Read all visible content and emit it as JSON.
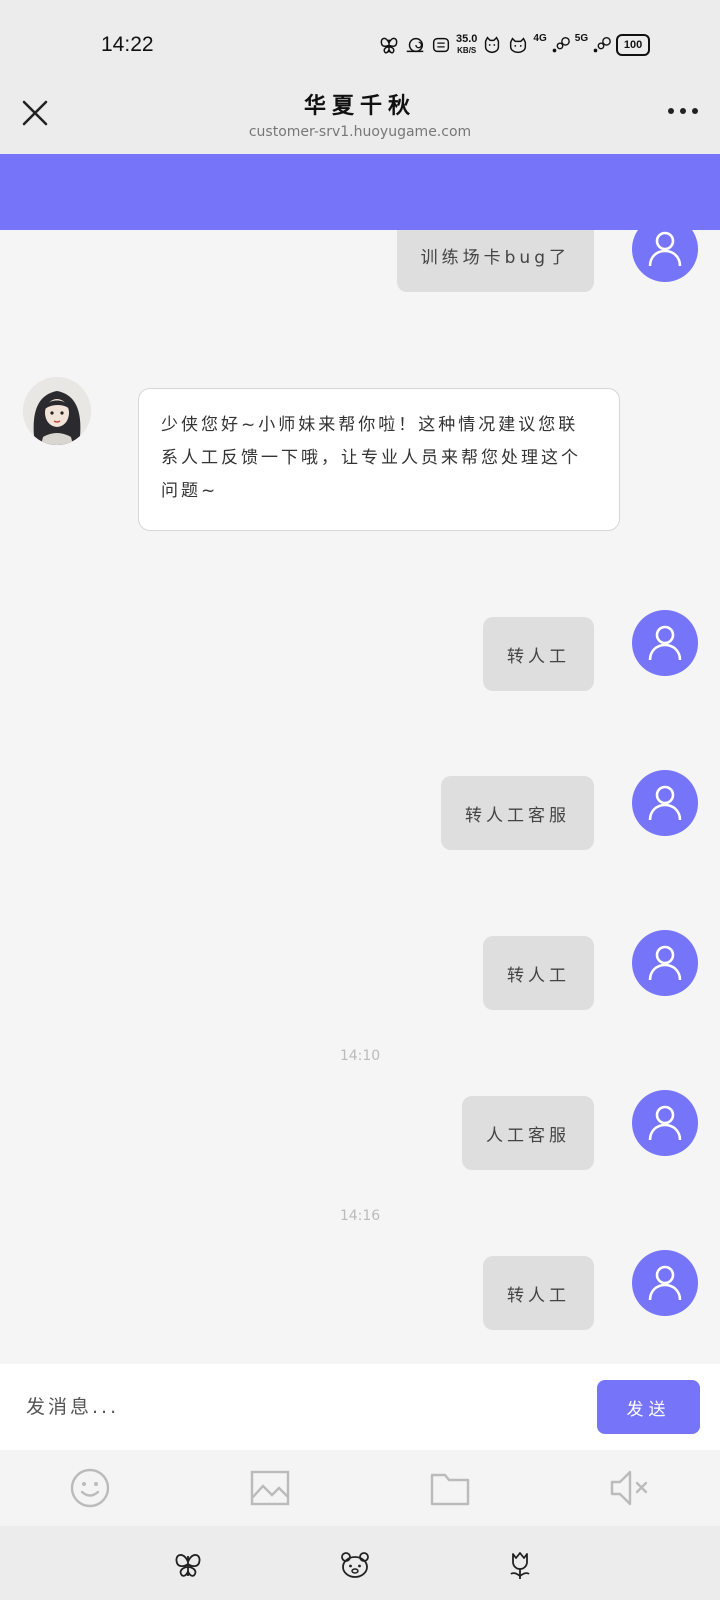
{
  "status_bar": {
    "time": "14:22",
    "net_speed": "35.0",
    "net_speed_unit": "KB/S",
    "signal_1": "4G",
    "signal_2": "5G",
    "battery": "100"
  },
  "header": {
    "title": "华夏千秋",
    "subtitle": "customer-srv1.huoyugame.com"
  },
  "colors": {
    "accent": "#7674f8",
    "user_bubble": "#dedede",
    "background": "#f5f5f5"
  },
  "messages": [
    {
      "from": "user",
      "text": "训练场卡bug了"
    },
    {
      "from": "bot",
      "text": "少侠您好~小师妹来帮你啦！这种情况建议您联系人工反馈一下哦，让专业人员来帮您处理这个问题~"
    },
    {
      "from": "user",
      "text": "转人工"
    },
    {
      "from": "user",
      "text": "转人工客服"
    },
    {
      "from": "user",
      "text": "转人工"
    },
    {
      "from": "user",
      "text": "人工客服"
    },
    {
      "from": "user",
      "text": "转人工"
    }
  ],
  "timestamps": [
    "14:10",
    "14:16"
  ],
  "composer": {
    "placeholder": "发消息...",
    "send_label": "发送"
  },
  "toolbar": {
    "icons": [
      "emoji-icon",
      "image-icon",
      "folder-icon",
      "mute-icon"
    ]
  },
  "nav_bar": {
    "icons": [
      "butterfly-icon",
      "bear-icon",
      "tulip-icon"
    ]
  }
}
